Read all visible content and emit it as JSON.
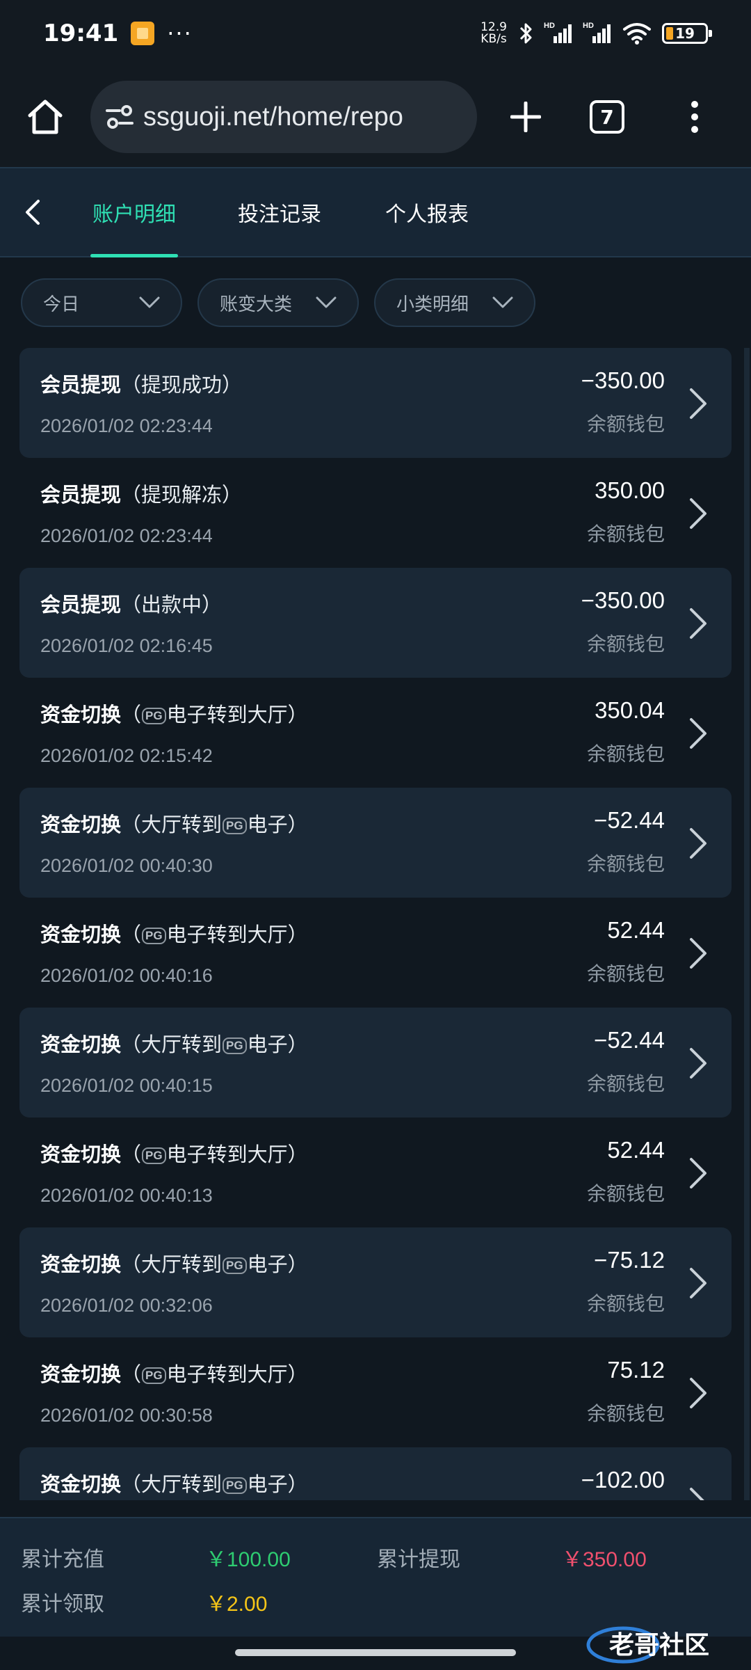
{
  "status_bar": {
    "time": "19:41",
    "net_speed_value": "12.9",
    "net_speed_unit": "KB/s",
    "battery": "19",
    "network_label": "HD",
    "wifi_sub": "6"
  },
  "browser": {
    "url": "ssguoji.net/home/repo",
    "tab_count": "7"
  },
  "tabs": [
    {
      "label": "账户明细",
      "active": true
    },
    {
      "label": "投注记录",
      "active": false
    },
    {
      "label": "个人报表",
      "active": false
    }
  ],
  "filters": [
    {
      "label": "今日"
    },
    {
      "label": "账变大类"
    },
    {
      "label": "小类明细"
    }
  ],
  "badge_text": "PG",
  "records": [
    {
      "title": "会员提现",
      "sub_pre": "（提现成功）",
      "pg": false,
      "sub_post": "",
      "time": "2026/01/02 02:23:44",
      "amount": "−350.00",
      "wallet": "余额钱包"
    },
    {
      "title": "会员提现",
      "sub_pre": "（提现解冻）",
      "pg": false,
      "sub_post": "",
      "time": "2026/01/02 02:23:44",
      "amount": "350.00",
      "wallet": "余额钱包"
    },
    {
      "title": "会员提现",
      "sub_pre": "（出款中）",
      "pg": false,
      "sub_post": "",
      "time": "2026/01/02 02:16:45",
      "amount": "−350.00",
      "wallet": "余额钱包"
    },
    {
      "title": "资金切换",
      "sub_pre": "（",
      "pg": true,
      "sub_post": "电子转到大厅）",
      "time": "2026/01/02 02:15:42",
      "amount": "350.04",
      "wallet": "余额钱包"
    },
    {
      "title": "资金切换",
      "sub_pre": "（大厅转到",
      "pg": true,
      "sub_post": "电子）",
      "time": "2026/01/02 00:40:30",
      "amount": "−52.44",
      "wallet": "余额钱包"
    },
    {
      "title": "资金切换",
      "sub_pre": "（",
      "pg": true,
      "sub_post": "电子转到大厅）",
      "time": "2026/01/02 00:40:16",
      "amount": "52.44",
      "wallet": "余额钱包"
    },
    {
      "title": "资金切换",
      "sub_pre": "（大厅转到",
      "pg": true,
      "sub_post": "电子）",
      "time": "2026/01/02 00:40:15",
      "amount": "−52.44",
      "wallet": "余额钱包"
    },
    {
      "title": "资金切换",
      "sub_pre": "（",
      "pg": true,
      "sub_post": "电子转到大厅）",
      "time": "2026/01/02 00:40:13",
      "amount": "52.44",
      "wallet": "余额钱包"
    },
    {
      "title": "资金切换",
      "sub_pre": "（大厅转到",
      "pg": true,
      "sub_post": "电子）",
      "time": "2026/01/02 00:32:06",
      "amount": "−75.12",
      "wallet": "余额钱包"
    },
    {
      "title": "资金切换",
      "sub_pre": "（",
      "pg": true,
      "sub_post": "电子转到大厅）",
      "time": "2026/01/02 00:30:58",
      "amount": "75.12",
      "wallet": "余额钱包"
    },
    {
      "title": "资金切换",
      "sub_pre": "（大厅转到",
      "pg": true,
      "sub_post": "电子）",
      "time": "",
      "amount": "−102.00",
      "wallet": ""
    }
  ],
  "summary": {
    "deposit_label": "累计充值",
    "deposit_value": "￥100.00",
    "withdraw_label": "累计提现",
    "withdraw_value": "￥350.00",
    "claim_label": "累计领取",
    "claim_value": "￥2.00"
  },
  "colors": {
    "accent": "#2fe0b4",
    "deposit": "#2ecc71",
    "withdraw": "#f0506e",
    "claim": "#f5c518"
  },
  "watermark": "老哥社区"
}
